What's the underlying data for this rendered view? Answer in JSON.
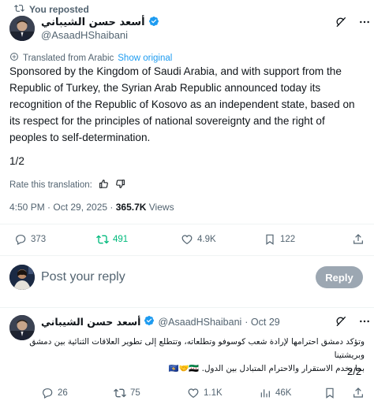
{
  "repost": {
    "label": "You reposted"
  },
  "post": {
    "author_name": "أسعد حسن الشيباني",
    "author_handle": "@AsaadHShaibani",
    "translated_label": "Translated from Arabic",
    "show_original": "Show original",
    "body_lines": [
      "Sponsored by the Kingdom of Saudi Arabia, and with support from the",
      "Republic of Turkey, the Syrian Arab Republic announced today its",
      "recognition of the Republic of Kosovo as an independent state, based on",
      "its respect for the principles of national sovereignty and the right of",
      "peoples to self-determination."
    ],
    "page_marker": "1/2",
    "rate_label": "Rate this translation:",
    "time": "4:50 PM · Oct 29, 2025 · ",
    "views_count": "365.7K",
    "views_label": " Views",
    "stats": {
      "replies": "373",
      "reposts": "491",
      "likes": "4.9K",
      "bookmarks": "122"
    }
  },
  "reply_box": {
    "placeholder": "Post your reply",
    "button": "Reply"
  },
  "thread": {
    "author_name": "أسعد حسن الشيباني",
    "author_handle": "@AsaadHShaibani",
    "date": "· Oct 29",
    "body_line1": "وتؤكد دمشق احترامها لإرادة شعب كوسوفو وتطلعاته، وتتطلع إلى تطوير العلاقات الثنائية بين دمشق وبريشتينا",
    "body_line2": "بما يخدم الاستقرار والاحترام المتبادل بين الدول.",
    "emoji": "🇽🇰🤝🇸🇾",
    "page_marker": "2/2",
    "stats": {
      "replies": "26",
      "reposts": "75",
      "likes": "1.1K",
      "views": "46K"
    }
  },
  "colors": {
    "repost_green": "#00ba7c",
    "verified_blue": "#1d9bf0",
    "muted": "#536471",
    "reply_button": "#8b98a5"
  },
  "icons": [
    "repost-icon",
    "verified-badge-icon",
    "grok-icon",
    "more-icon",
    "translate-icon",
    "thumbs-up-icon",
    "thumbs-down-icon",
    "reply-icon",
    "like-icon",
    "bookmark-icon",
    "views-icon",
    "share-icon"
  ]
}
